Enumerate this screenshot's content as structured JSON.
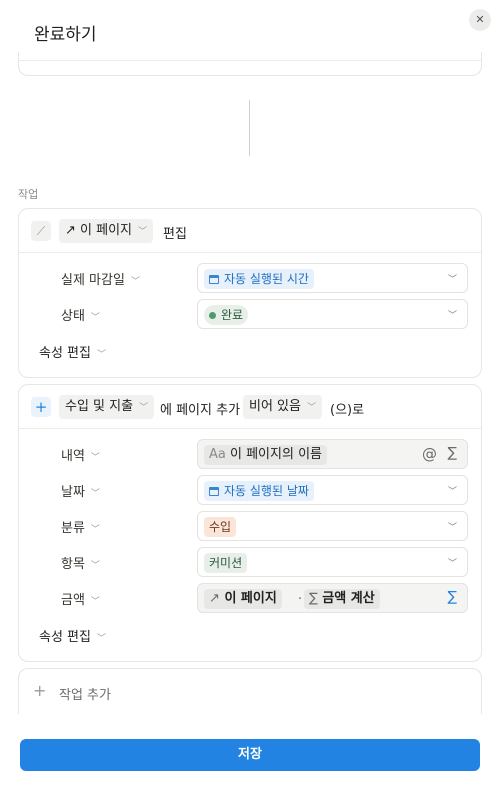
{
  "dialog": {
    "title": "완료하기"
  },
  "section_label": "작업",
  "action1": {
    "target_chip": "이 페이지",
    "verb": "편집",
    "properties": [
      {
        "label": "실제 마감일",
        "value": "자동 실행된 시간",
        "type": "date"
      },
      {
        "label": "상태",
        "value": "완료",
        "type": "status"
      }
    ],
    "edit_props_label": "속성 편집"
  },
  "action2": {
    "db_chip": "수입 및 지출",
    "text_add": "에 페이지 추가",
    "mode_chip": "비어 있음",
    "suffix": "(으)로",
    "properties": [
      {
        "label": "내역",
        "value": "이 페이지의 이름",
        "prefix": "Aa"
      },
      {
        "label": "날짜",
        "value": "자동 실행된 날짜"
      },
      {
        "label": "분류",
        "value": "수입"
      },
      {
        "label": "항목",
        "value": "커미션"
      },
      {
        "label": "금액",
        "value": "이 페이지",
        "value2": "금액 계산"
      }
    ],
    "edit_props_label": "속성 편집"
  },
  "add_action_label": "작업 추가",
  "save_label": "저장",
  "colors": {
    "accent": "#2383e2",
    "status_green": "#4f9a6a",
    "tag_orange": "#fbe5d8"
  }
}
